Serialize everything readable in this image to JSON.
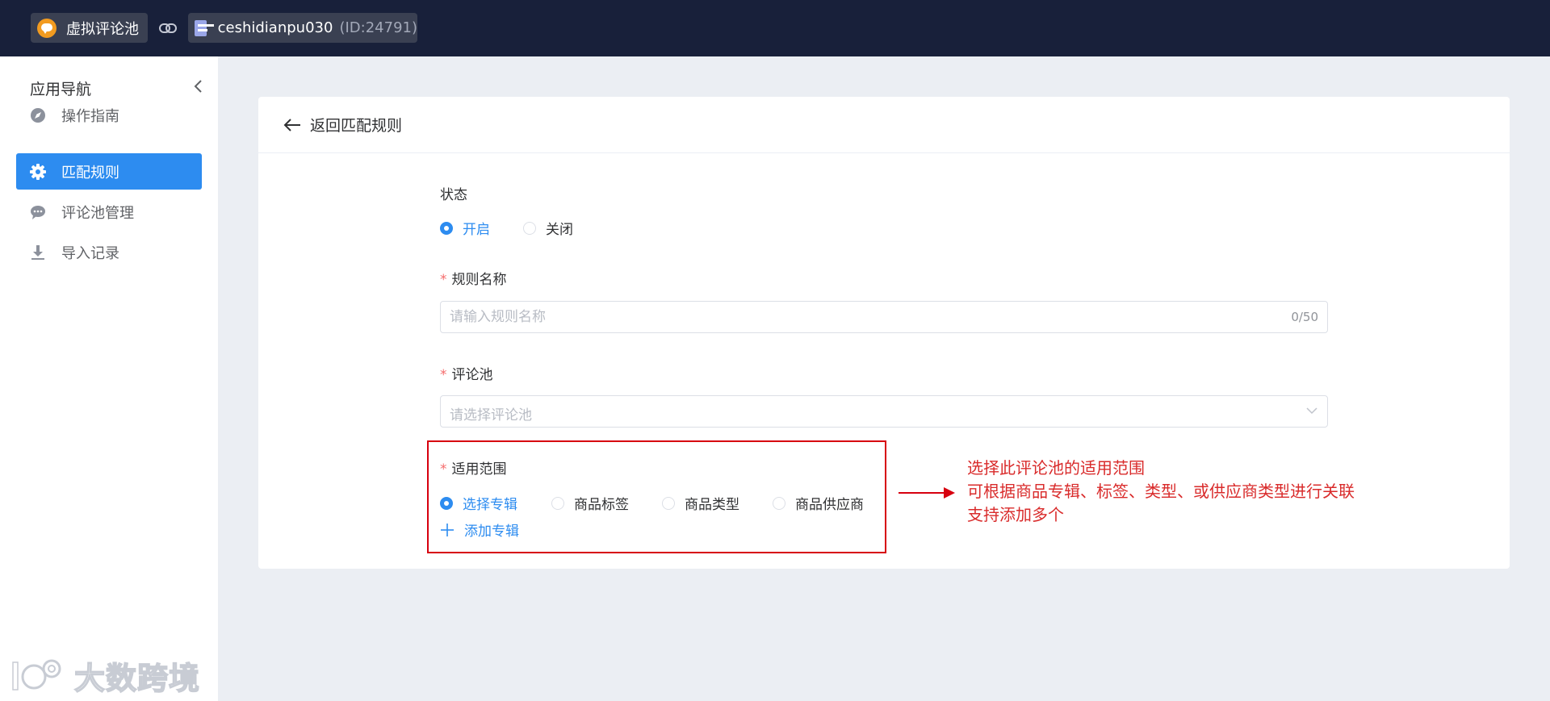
{
  "topbar": {
    "app_name": "虚拟评论池",
    "shop_name": "ceshidianpu030",
    "shop_id": "(ID:24791)"
  },
  "sidebar": {
    "title": "应用导航",
    "items": [
      {
        "label": "操作指南",
        "icon": "compass-icon",
        "active": false
      },
      {
        "label": "匹配规则",
        "icon": "gear-icon",
        "active": true
      },
      {
        "label": "评论池管理",
        "icon": "comment-icon",
        "active": false
      },
      {
        "label": "导入记录",
        "icon": "download-icon",
        "active": false
      }
    ]
  },
  "watermark": {
    "text": "大数跨境"
  },
  "header": {
    "back_label": "返回匹配规则"
  },
  "form": {
    "status": {
      "label": "状态",
      "options": [
        "开启",
        "关闭"
      ],
      "selected": "开启"
    },
    "rule_name": {
      "label": "规则名称",
      "required": "*",
      "placeholder": "请输入规则名称",
      "value": "",
      "counter": "0/50"
    },
    "comment_pool": {
      "label": "评论池",
      "required": "*",
      "placeholder": "请选择评论池"
    },
    "scope": {
      "label": "适用范围",
      "required": "*",
      "options": [
        "选择专辑",
        "商品标签",
        "商品类型",
        "商品供应商"
      ],
      "selected": "选择专辑",
      "add_label": "添加专辑"
    }
  },
  "annotation": {
    "lines": [
      "选择此评论池的适用范围",
      "可根据商品专辑、标签、类型、或供应商类型进行关联",
      "支持添加多个"
    ],
    "color": "#d92b2b"
  },
  "colors": {
    "topbar": "#18203a",
    "accent": "#2d8cf0",
    "highlight_box": "#d7000f",
    "page_bg": "#ebeef3"
  }
}
